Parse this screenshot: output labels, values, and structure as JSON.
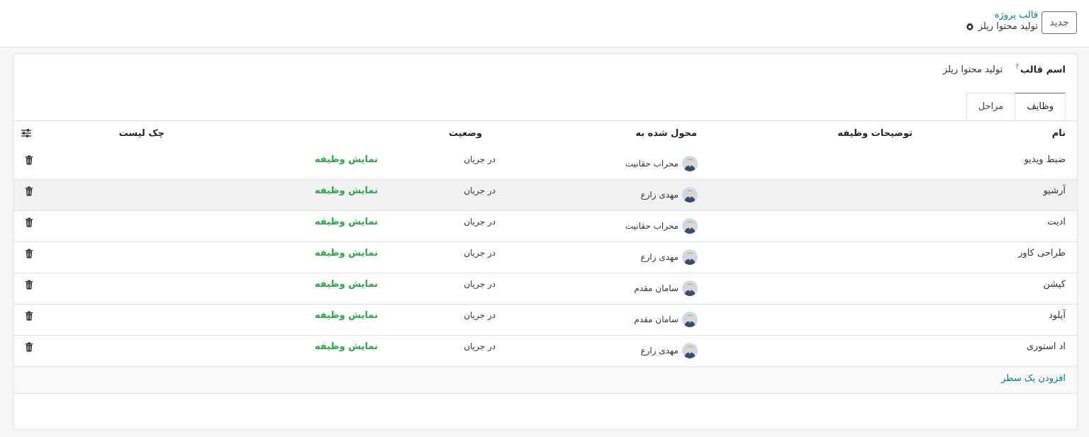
{
  "header": {
    "new_button": "جدید",
    "breadcrumb": "قالب پروژه",
    "record_title": "تولید محتوا ریلز"
  },
  "form": {
    "template_name_label": "اسم قالب",
    "help_mark": "?",
    "template_name_value": "تولید محتوا ریلز"
  },
  "tabs": [
    {
      "label": "وظایف",
      "active": true
    },
    {
      "label": "مراحل",
      "active": false
    }
  ],
  "table": {
    "columns": {
      "name": "نام",
      "description": "توضیحات وظیفه",
      "assignee": "محول شده به",
      "status": "وضعیت",
      "checklist": "چک لیست"
    },
    "rows": [
      {
        "name": "ضبط ویدیو",
        "assignee": "محراب حقانیت",
        "status": "در جریان",
        "action": "نمایش وظیفه"
      },
      {
        "name": "آرشیو",
        "assignee": "مهدی زارع",
        "status": "در جریان",
        "action": "نمایش وظیفه"
      },
      {
        "name": "ادیت",
        "assignee": "محراب حقانیت",
        "status": "در جریان",
        "action": "نمایش وظیفه"
      },
      {
        "name": "طراحی کاور",
        "assignee": "مهدی زارع",
        "status": "در جریان",
        "action": "نمایش وظیفه"
      },
      {
        "name": "کپشن",
        "assignee": "سامان مقدم",
        "status": "در جریان",
        "action": "نمایش وظیفه"
      },
      {
        "name": "آپلود",
        "assignee": "سامان مقدم",
        "status": "در جریان",
        "action": "نمایش وظیفه"
      },
      {
        "name": "اد استوری",
        "assignee": "مهدی زارع",
        "status": "در جریان",
        "action": "نمایش وظیفه"
      }
    ],
    "add_line": "افزودن یک سطر"
  },
  "icons": {
    "gear": "gear-icon",
    "trash": "trash-icon",
    "settings": "optional-columns-icon",
    "avatar": "avatar"
  },
  "colors": {
    "accent": "#71639e",
    "link_green": "#28a745",
    "teal": "#017e84"
  }
}
